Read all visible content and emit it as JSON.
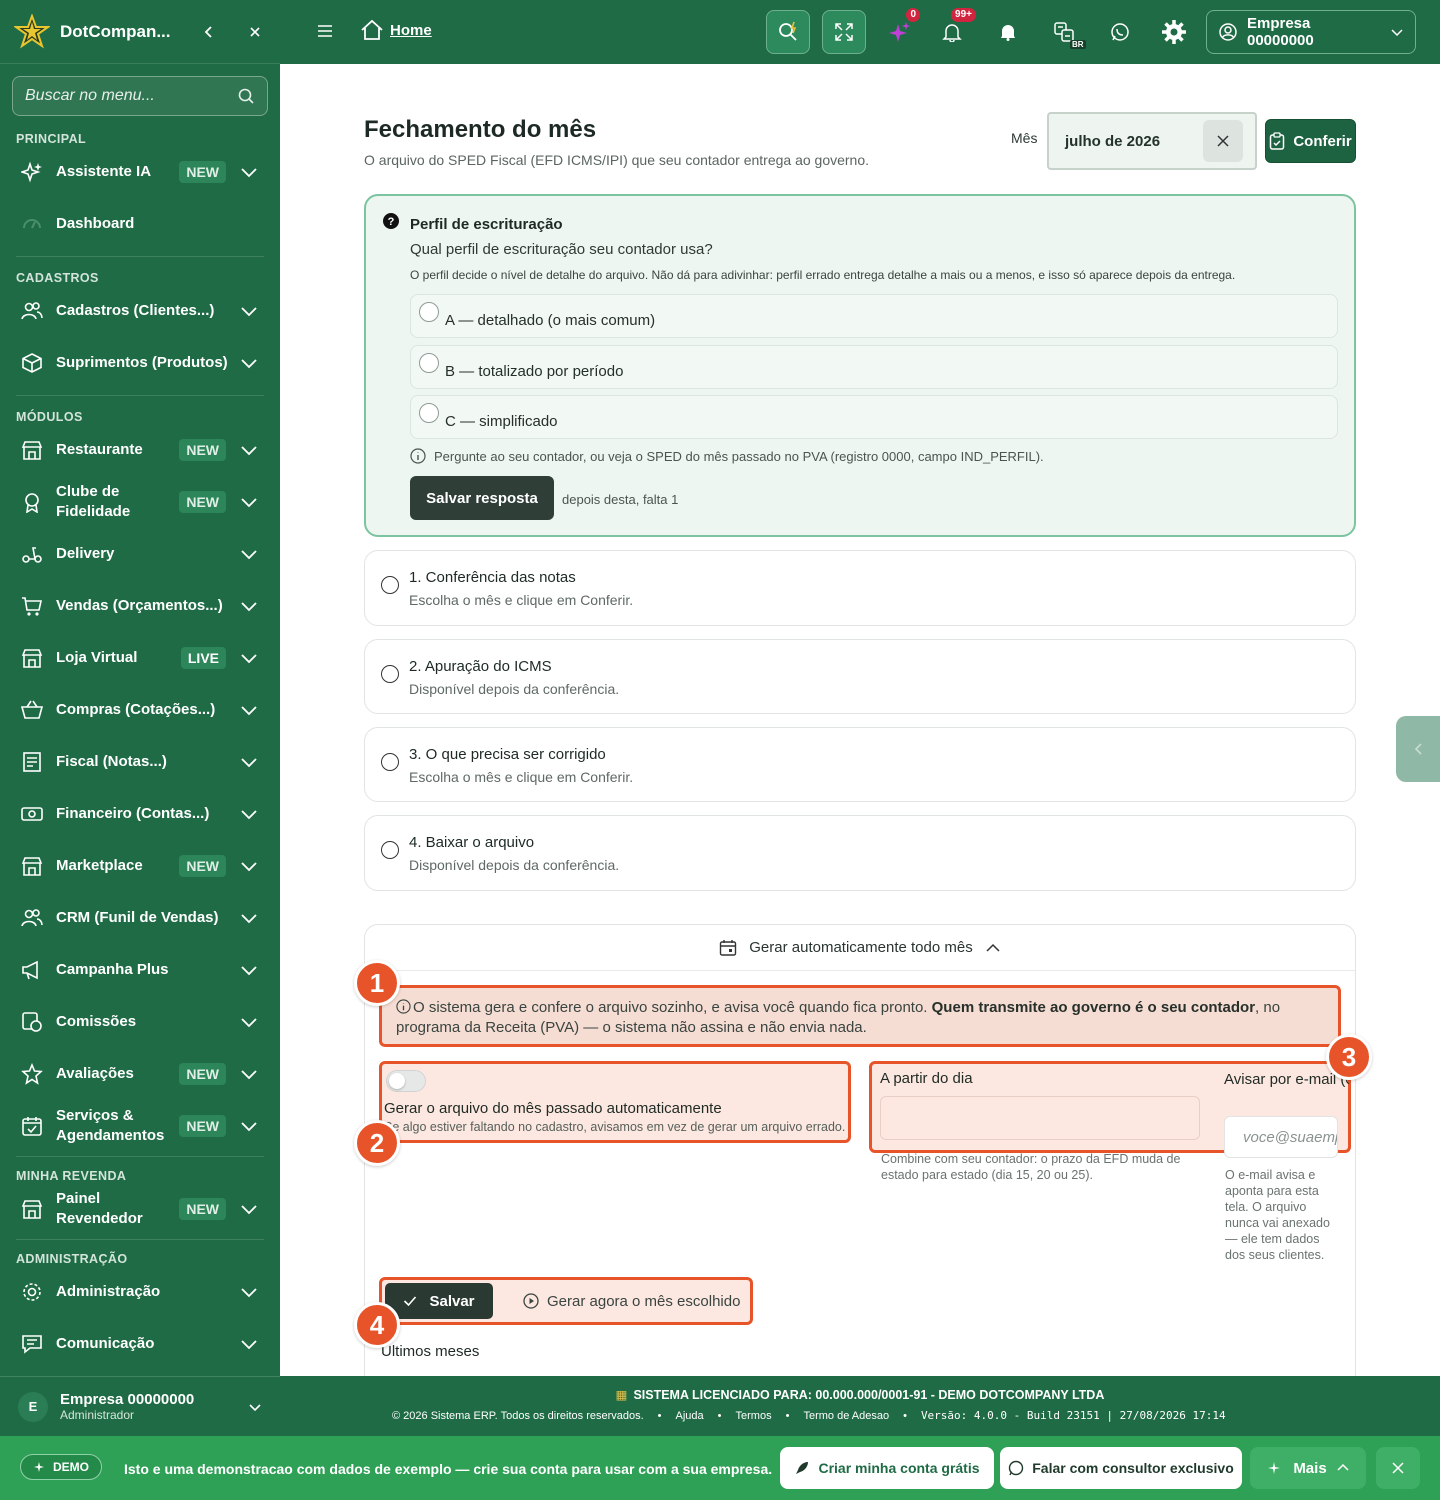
{
  "sidebar": {
    "brand": "DotCompan...",
    "search_placeholder": "Buscar no menu...",
    "sections": {
      "principal": "PRINCIPAL",
      "cadastros": "CADASTROS",
      "modulos": "MÓDULOS",
      "revenda": "MINHA REVENDA",
      "admin": "ADMINISTRAÇÃO"
    },
    "items": {
      "assistente": {
        "label": "Assistente IA",
        "badge": "NEW"
      },
      "dashboard": {
        "label": "Dashboard"
      },
      "cadastros": {
        "label": "Cadastros (Clientes...)"
      },
      "suprimentos": {
        "label": "Suprimentos (Produtos)"
      },
      "restaurante": {
        "label": "Restaurante",
        "badge": "NEW"
      },
      "clube": {
        "label": "Clube de Fidelidade",
        "badge": "NEW"
      },
      "delivery": {
        "label": "Delivery"
      },
      "vendas": {
        "label": "Vendas (Orçamentos...)"
      },
      "loja": {
        "label": "Loja Virtual",
        "badge": "LIVE"
      },
      "compras": {
        "label": "Compras (Cotações...)"
      },
      "fiscal": {
        "label": "Fiscal (Notas...)"
      },
      "financeiro": {
        "label": "Financeiro (Contas...)"
      },
      "marketplace": {
        "label": "Marketplace",
        "badge": "NEW"
      },
      "crm": {
        "label": "CRM (Funil de Vendas)"
      },
      "campanha": {
        "label": "Campanha Plus"
      },
      "comissoes": {
        "label": "Comissões"
      },
      "avaliacoes": {
        "label": "Avaliações",
        "badge": "NEW"
      },
      "servicos": {
        "label": "Serviços & Agendamentos",
        "badge": "NEW"
      },
      "painel": {
        "label": "Painel Revendedor",
        "badge": "NEW"
      },
      "administracao": {
        "label": "Administração"
      },
      "comunicacao": {
        "label": "Comunicação"
      }
    },
    "user": {
      "initial": "E",
      "name": "Empresa 00000000",
      "role": "Administrador"
    }
  },
  "topbar": {
    "home": "Home",
    "ai_count": "0",
    "notif_count": "99+",
    "lang_badge": "BR",
    "company": "Empresa 00000000"
  },
  "page": {
    "title": "Fechamento do mês",
    "subtitle": "O arquivo do SPED Fiscal (EFD ICMS/IPI) que seu contador entrega ao governo.",
    "month_label": "Mês",
    "month_value": "julho de 2026",
    "confirm_button": "Conferir"
  },
  "perfil": {
    "title": "Perfil de escrituração",
    "question": "Qual perfil de escrituração seu contador usa?",
    "description": "O perfil decide o nível de detalhe do arquivo. Não dá para adivinhar: perfil errado entrega detalhe a mais ou a menos, e isso só aparece depois da entrega.",
    "options": [
      "A — detalhado (o mais comum)",
      "B — totalizado por período",
      "C — simplificado"
    ],
    "hint": "Pergunte ao seu contador, ou veja o SPED do mês passado no PVA (registro 0000, campo IND_PERFIL).",
    "save_button": "Salvar resposta",
    "remaining": "depois desta, falta 1"
  },
  "steps": [
    {
      "title": "1. Conferência das notas",
      "subtitle": "Escolha o mês e clique em Conferir."
    },
    {
      "title": "2. Apuração do ICMS",
      "subtitle": "Disponível depois da conferência."
    },
    {
      "title": "3. O que precisa ser corrigido",
      "subtitle": "Escolha o mês e clique em Conferir."
    },
    {
      "title": "4. Baixar o arquivo",
      "subtitle": "Disponível depois da conferência."
    }
  ],
  "auto": {
    "header": "Gerar automaticamente todo mês",
    "info_part1": "O sistema gera e confere o arquivo sozinho, e avisa você quando fica pronto. ",
    "info_bold": "Quem transmite ao governo é o seu contador",
    "info_part2": ", no programa da Receita (PVA) — o sistema não assina e não envia nada.",
    "toggle_label": "Gerar o arquivo do mês passado automaticamente",
    "toggle_help": "Se algo estiver faltando no cadastro, avisamos em vez de gerar um arquivo errado.",
    "day_label": "A partir do dia",
    "day_value": "",
    "day_help": "Combine com seu contador: o prazo da EFD muda de estado para estado (dia 15, 20 ou 25).",
    "email_label": "Avisar por e-mail (opcional)",
    "email_placeholder": "voce@suaempresa.com",
    "email_help": "O e-mail avisa e aponta para esta tela. O arquivo nunca vai anexado — ele tem dados dos seus clientes.",
    "save_button": "Salvar",
    "generate_button": "Gerar agora o mês escolhido",
    "history_title": "Últimos meses",
    "callouts": [
      "1",
      "2",
      "3",
      "4"
    ]
  },
  "footer": {
    "license": "SISTEMA LICENCIADO PARA: 00.000.000/0001-91 - DEMO DOTCOMPANY LTDA",
    "copyright": "© 2026 Sistema ERP. Todos os direitos reservados.",
    "links": [
      "Ajuda",
      "Termos",
      "Termo de Adesao"
    ],
    "version": "Versão: 4.0.0 - Build 23151 | 27/08/2026 17:14"
  },
  "demo": {
    "pill": "DEMO",
    "message": "Isto e uma demonstracao com dados de exemplo — crie sua conta para usar com a sua empresa.",
    "create_button": "Criar minha conta grátis",
    "consultant_button": "Falar com consultor exclusivo",
    "more_button": "Mais"
  },
  "colors": {
    "brand": "#1f6b45",
    "accent": "#e8542a",
    "demo_bar": "#2fa157"
  }
}
